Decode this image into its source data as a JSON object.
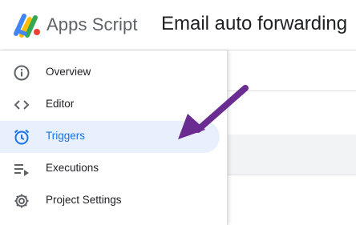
{
  "header": {
    "app_name": "Apps Script",
    "project_title": "Email auto forwarding",
    "logo_icon": "apps-script-logo"
  },
  "sidebar": {
    "items": [
      {
        "label": "Overview",
        "icon": "info-icon",
        "active": false
      },
      {
        "label": "Editor",
        "icon": "code-icon",
        "active": false
      },
      {
        "label": "Triggers",
        "icon": "alarm-clock-icon",
        "active": true
      },
      {
        "label": "Executions",
        "icon": "executions-list-icon",
        "active": false
      },
      {
        "label": "Project Settings",
        "icon": "gear-icon",
        "active": false
      }
    ]
  },
  "annotation": {
    "icon": "arrow-annotation",
    "color": "#6a2c91"
  },
  "colors": {
    "accent": "#1a73e8",
    "active_bg": "#e8f0fe",
    "text": "#202124",
    "icon_gray": "#5f6368"
  }
}
